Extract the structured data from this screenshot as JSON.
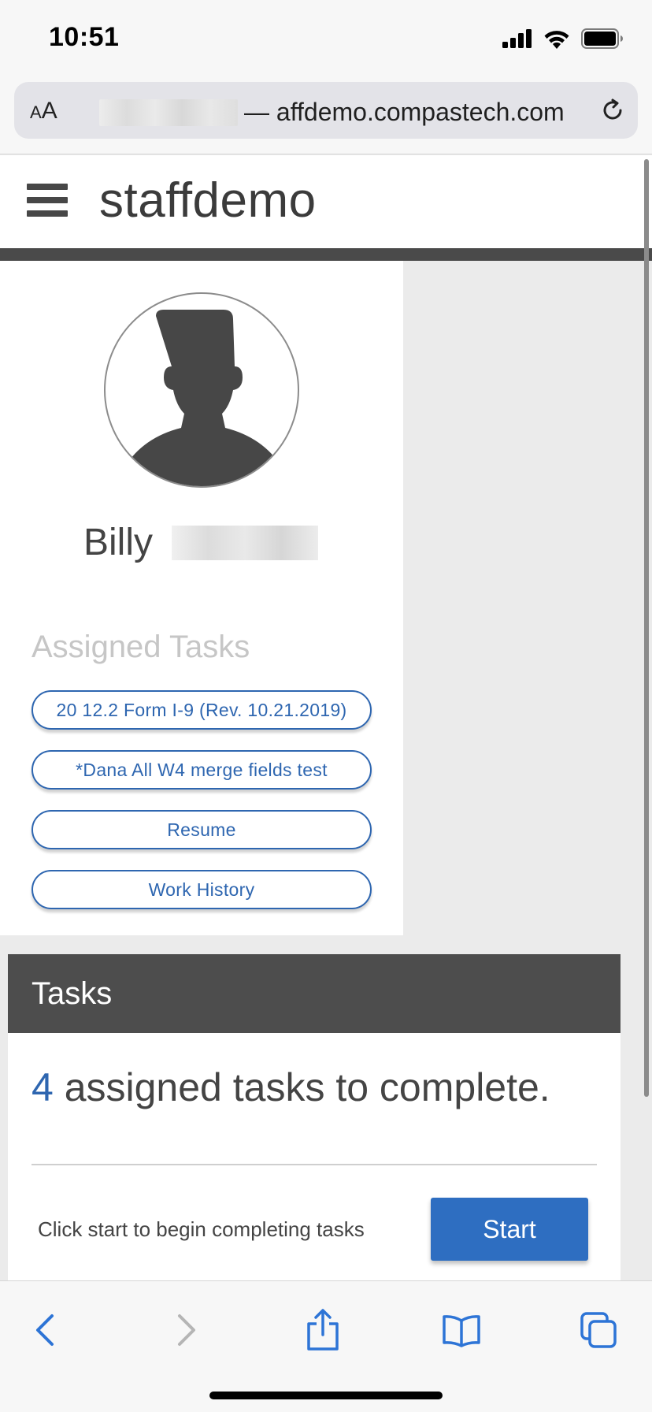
{
  "status_bar": {
    "time": "10:51"
  },
  "address_bar": {
    "text_size_label_small": "A",
    "text_size_label_large": "A",
    "url": "— affdemo.compastech.com"
  },
  "site": {
    "brand": "staffdemo"
  },
  "profile": {
    "name": "Billy",
    "assigned_tasks_heading": "Assigned Tasks",
    "assigned_tasks": [
      "20 12.2 Form I-9 (Rev. 10.21.2019)",
      "*Dana All W4 merge fields test",
      "Resume",
      "Work History"
    ]
  },
  "tasks_card": {
    "title": "Tasks",
    "count": "4",
    "count_suffix": " assigned tasks to complete.",
    "hint": "Click start to begin completing tasks",
    "start_label": "Start"
  },
  "toolbar": {
    "icons": [
      "back-icon",
      "forward-icon",
      "share-icon",
      "bookmarks-icon",
      "tabs-icon"
    ]
  },
  "colors": {
    "accent": "#2e6ec1",
    "header_dark": "#4d4d4d",
    "ios_blue": "#2d74d6"
  }
}
